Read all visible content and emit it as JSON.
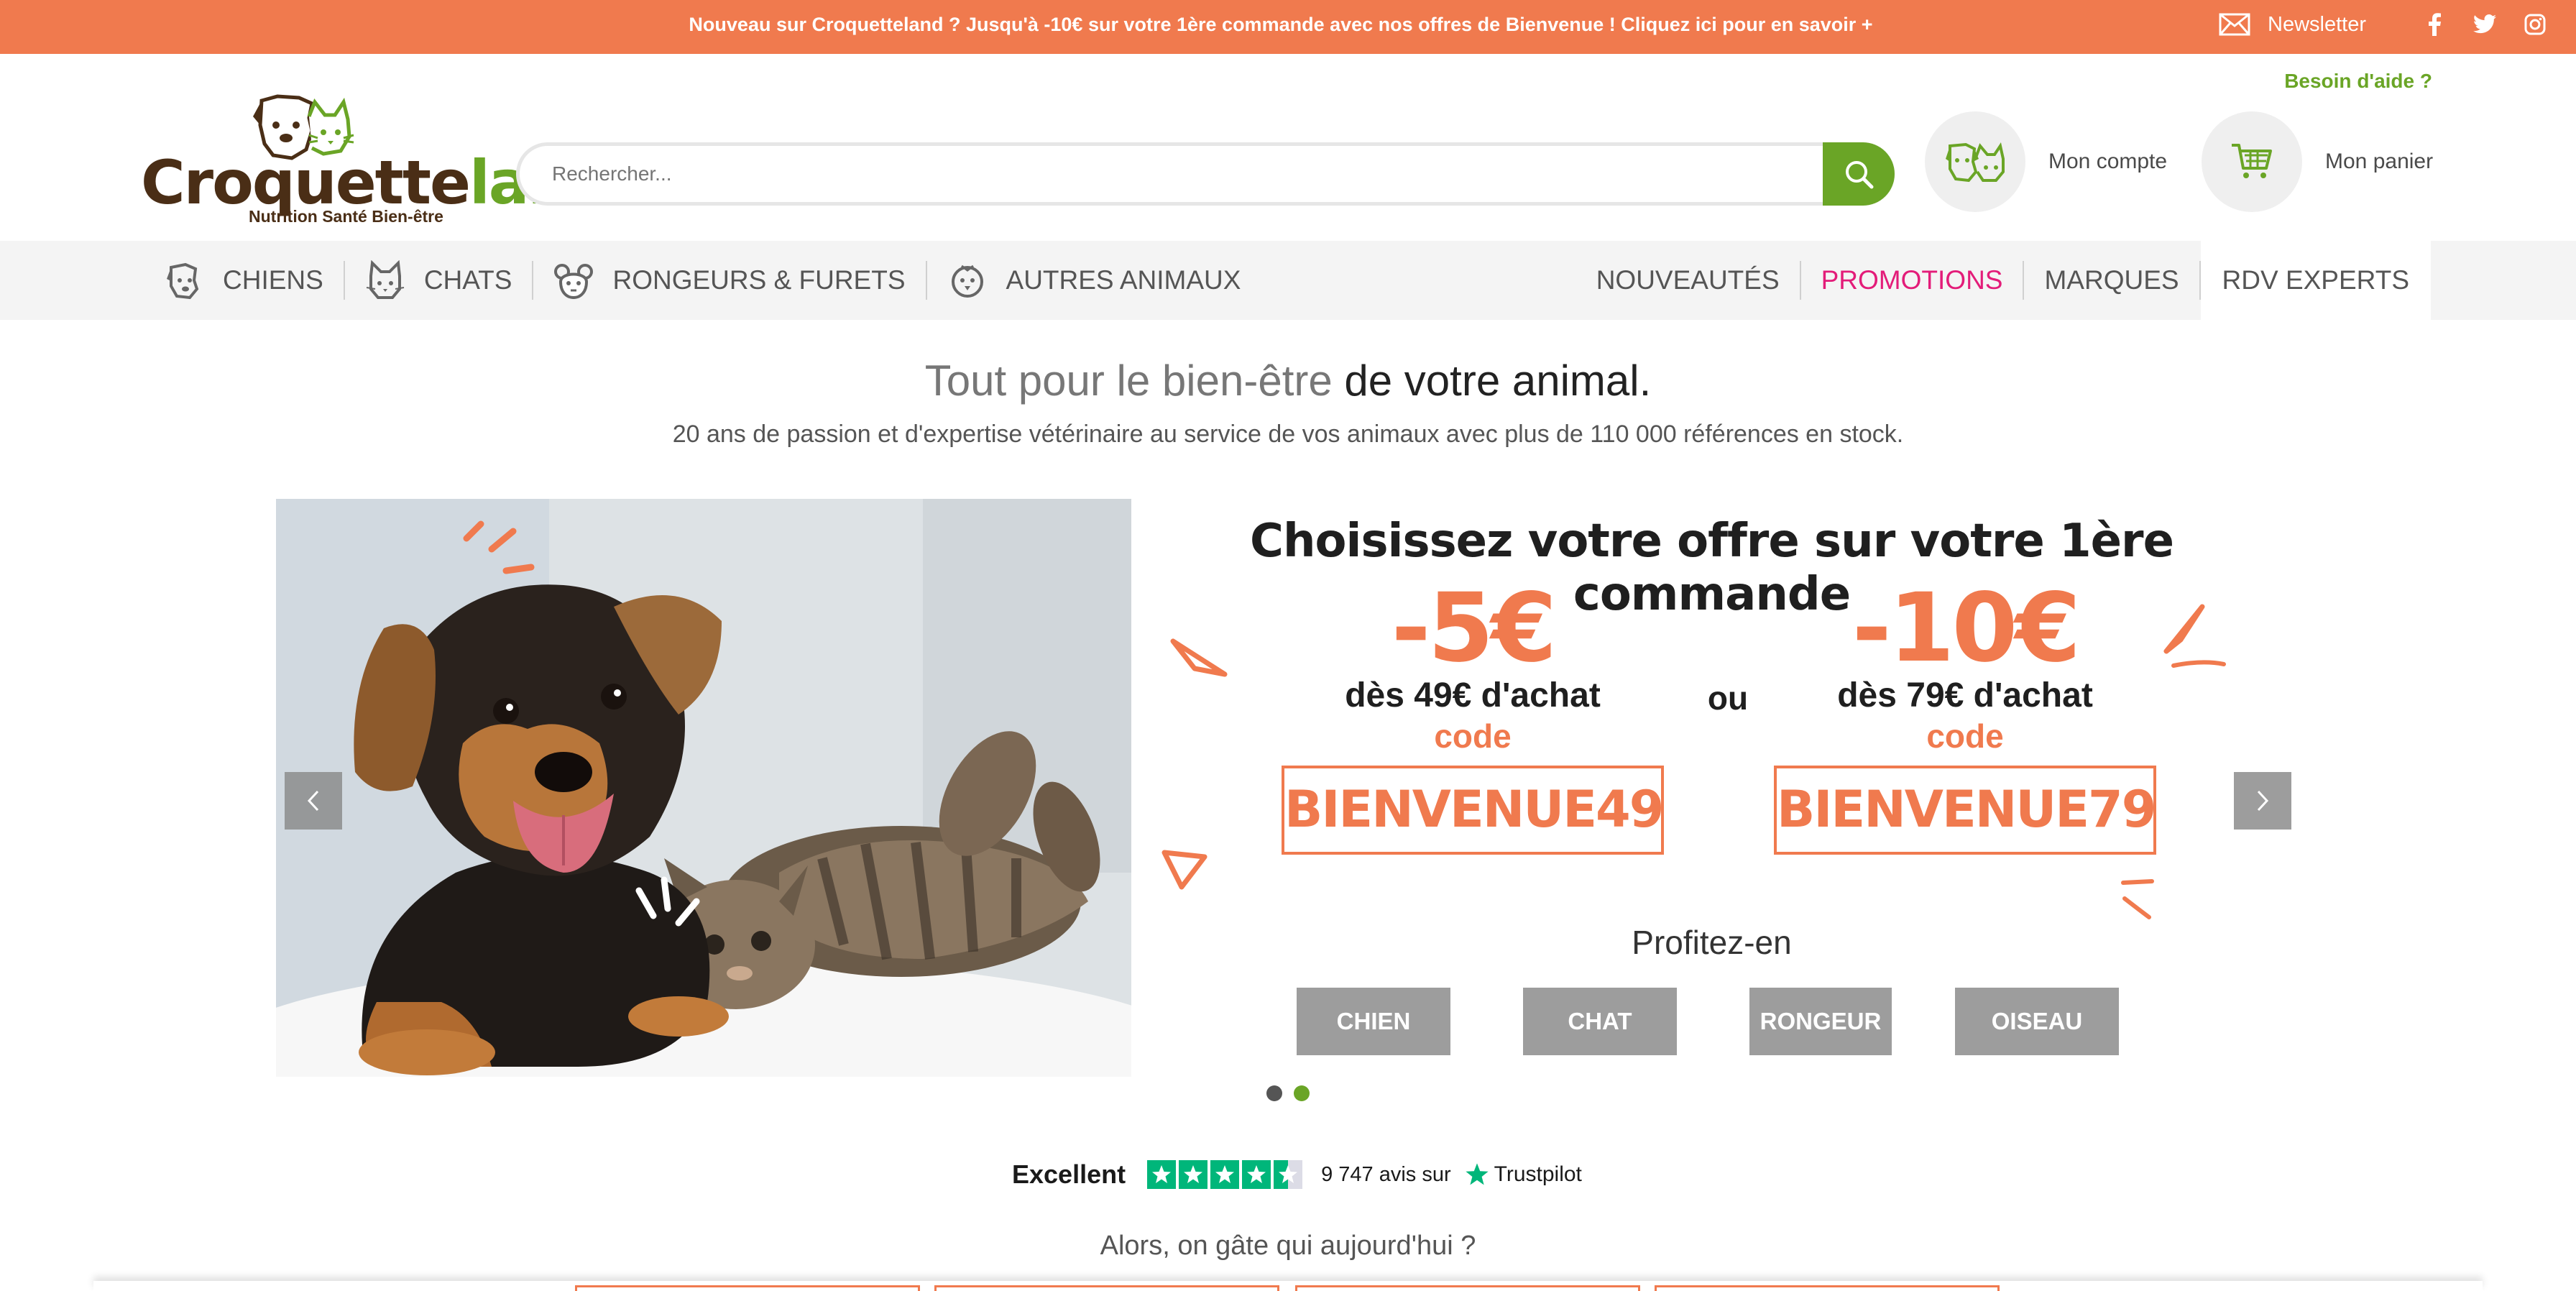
{
  "topbar": {
    "promo_text": "Nouveau sur Croquetteland ? Jusqu'à -10€ sur votre 1ère commande avec nos offres de Bienvenue ! Cliquez ici pour en savoir +",
    "newsletter": "Newsletter",
    "social": [
      "facebook-icon",
      "twitter-icon",
      "instagram-icon"
    ]
  },
  "header": {
    "help": "Besoin d'aide ?",
    "logo": {
      "brand_a": "Croquette",
      "brand_b": "land",
      "tagline": "Nutrition Santé Bien-être"
    },
    "search": {
      "placeholder": "Rechercher..."
    },
    "account_label": "Mon compte",
    "cart_label": "Mon panier"
  },
  "nav": {
    "left": [
      {
        "label": "CHIENS",
        "icon": "dog-icon"
      },
      {
        "label": "CHATS",
        "icon": "cat-icon"
      },
      {
        "label": "RONGEURS & FURETS",
        "icon": "rodent-icon"
      },
      {
        "label": "AUTRES ANIMAUX",
        "icon": "bird-icon"
      }
    ],
    "right": [
      {
        "label": "NOUVEAUTÉS"
      },
      {
        "label": "PROMOTIONS"
      },
      {
        "label": "MARQUES"
      },
      {
        "label": "RDV EXPERTS"
      }
    ]
  },
  "hero": {
    "headline_grey": "Tout pour le bien-être",
    "headline_dark": " de votre animal.",
    "subline": "20 ans de passion et d'expertise vétérinaire au service de vos animaux avec plus de 110 000 références en stock."
  },
  "slide": {
    "title": "Choisissez votre offre sur votre 1ère commande",
    "offers": [
      {
        "amount": "-5€",
        "condition": "dès 49€ d'achat",
        "code_label": "code",
        "code": "BIENVENUE49"
      },
      {
        "amount": "-10€",
        "condition": "dès 79€ d'achat",
        "code_label": "code",
        "code": "BIENVENUE79"
      }
    ],
    "or": "ou",
    "profitez": "Profitez-en",
    "categories": [
      "CHIEN",
      "CHAT",
      "RONGEUR",
      "OISEAU"
    ],
    "slide_count": 2,
    "active_slide": 2
  },
  "trustpilot": {
    "rating": "Excellent",
    "stars": 4.5,
    "count": "9 747 avis sur",
    "brand": "Trustpilot"
  },
  "section": {
    "question": "Alors, on gâte qui aujourd'hui ?"
  },
  "colors": {
    "orange": "#f07a4e",
    "green": "#6aa526",
    "pink": "#e31c79",
    "tp_green": "#00b67a"
  }
}
